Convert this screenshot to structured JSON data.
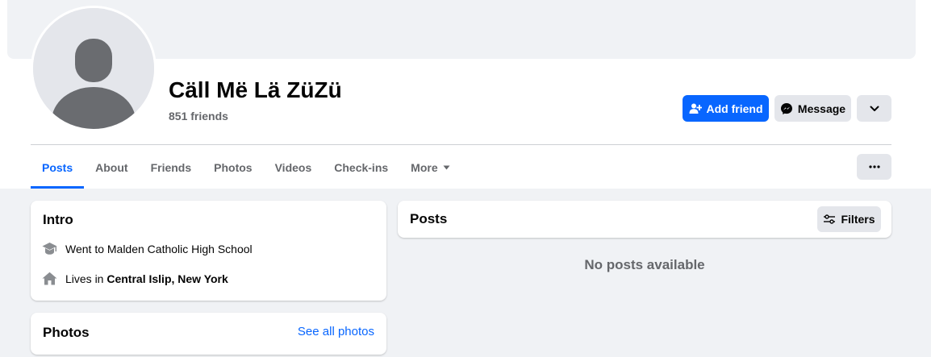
{
  "profile": {
    "name": "Cäll Më Lä ZüZü",
    "friends_count": "851 friends"
  },
  "actions": {
    "add_friend": "Add friend",
    "message": "Message"
  },
  "tabs": [
    {
      "label": "Posts",
      "active": true
    },
    {
      "label": "About"
    },
    {
      "label": "Friends"
    },
    {
      "label": "Photos"
    },
    {
      "label": "Videos"
    },
    {
      "label": "Check-ins"
    },
    {
      "label": "More"
    }
  ],
  "intro": {
    "title": "Intro",
    "education_prefix": "Went to Malden Catholic High School",
    "lives_prefix": "Lives in",
    "lives_place": "Central Islip, New York"
  },
  "photos": {
    "title": "Photos",
    "see_all": "See all photos"
  },
  "posts": {
    "title": "Posts",
    "filters": "Filters",
    "empty_message": "No posts available"
  },
  "icons": {
    "add_friend": "person-plus-icon",
    "message": "messenger-icon",
    "dropdown": "chevron-down-icon",
    "more_options": "ellipsis-icon",
    "tab_more": "caret-down-icon",
    "education": "graduation-cap-icon",
    "home": "house-icon",
    "filters": "sliders-icon"
  },
  "colors": {
    "accent": "#0866ff",
    "secondary_text": "#65676b",
    "button_gray": "#e4e6eb",
    "page_background": "#f0f2f5"
  }
}
